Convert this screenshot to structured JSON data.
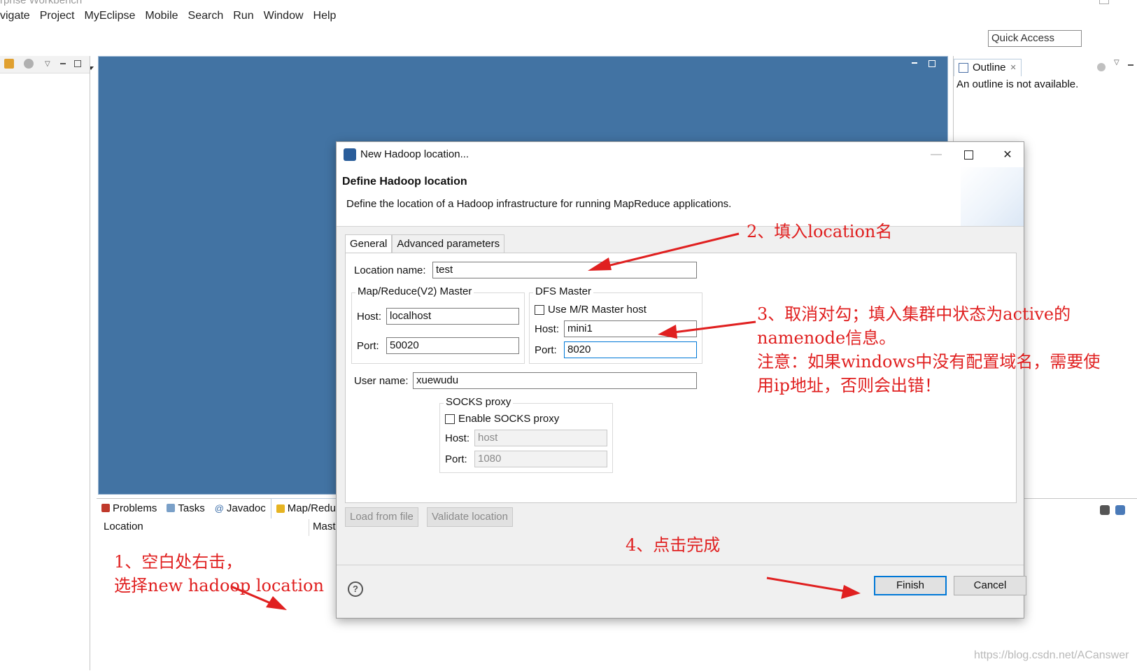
{
  "window": {
    "title": "rprise Workbench"
  },
  "menu": [
    "vigate",
    "Project",
    "MyEclipse",
    "Mobile",
    "Search",
    "Run",
    "Window",
    "Help"
  ],
  "toolbar": {
    "quick_access": "Quick Access"
  },
  "outline": {
    "tab_label": "Outline",
    "close_glyph": "✕",
    "message": "An outline is not available."
  },
  "bottom": {
    "tabs": [
      "Problems",
      "Tasks",
      "Javadoc",
      "Map/Reduce"
    ],
    "col_location": "Location",
    "col_master": "Mast"
  },
  "dialog": {
    "title": "New Hadoop location...",
    "heading": "Define Hadoop location",
    "description": "Define the location of a Hadoop infrastructure for running MapReduce applications.",
    "tabs": [
      "General",
      "Advanced parameters"
    ],
    "location_name_label": "Location name:",
    "location_name_value": "test",
    "mr_master_group": "Map/Reduce(V2) Master",
    "mr_host_label": "Host:",
    "mr_host_value": "localhost",
    "mr_port_label": "Port:",
    "mr_port_value": "50020",
    "dfs_group": "DFS Master",
    "dfs_use_mr_label": "Use M/R Master host",
    "dfs_host_label": "Host:",
    "dfs_host_value": "mini1",
    "dfs_port_label": "Port:",
    "dfs_port_value": "8020",
    "username_label": "User name:",
    "username_value": "xuewudu",
    "socks_group": "SOCKS proxy",
    "socks_enable_label": "Enable SOCKS proxy",
    "socks_host_label": "Host:",
    "socks_host_value": "host",
    "socks_port_label": "Port:",
    "socks_port_value": "1080",
    "load_button": "Load from file",
    "validate_button": "Validate location",
    "finish_button": "Finish",
    "cancel_button": "Cancel",
    "help_glyph": "?",
    "close_glyph": "✕",
    "minimize_glyph": "—"
  },
  "annotations": {
    "a1_line1": "1、空白处右击，",
    "a1_line2": "选择new hadoop location",
    "a2": "2、填入location名",
    "a3_line1": "3、取消对勾；填入集群中状态为active的",
    "a3_line2": "namenode信息。",
    "a3_line3": "注意：如果windows中没有配置域名，需要使",
    "a3_line4": "用ip地址，否则会出错！",
    "a4": "4、点击完成"
  },
  "watermark": "https://blog.csdn.net/ACanswer",
  "colors": {
    "editor_bg": "#4273a3",
    "annotation": "#e02020",
    "accent": "#0078d7"
  }
}
